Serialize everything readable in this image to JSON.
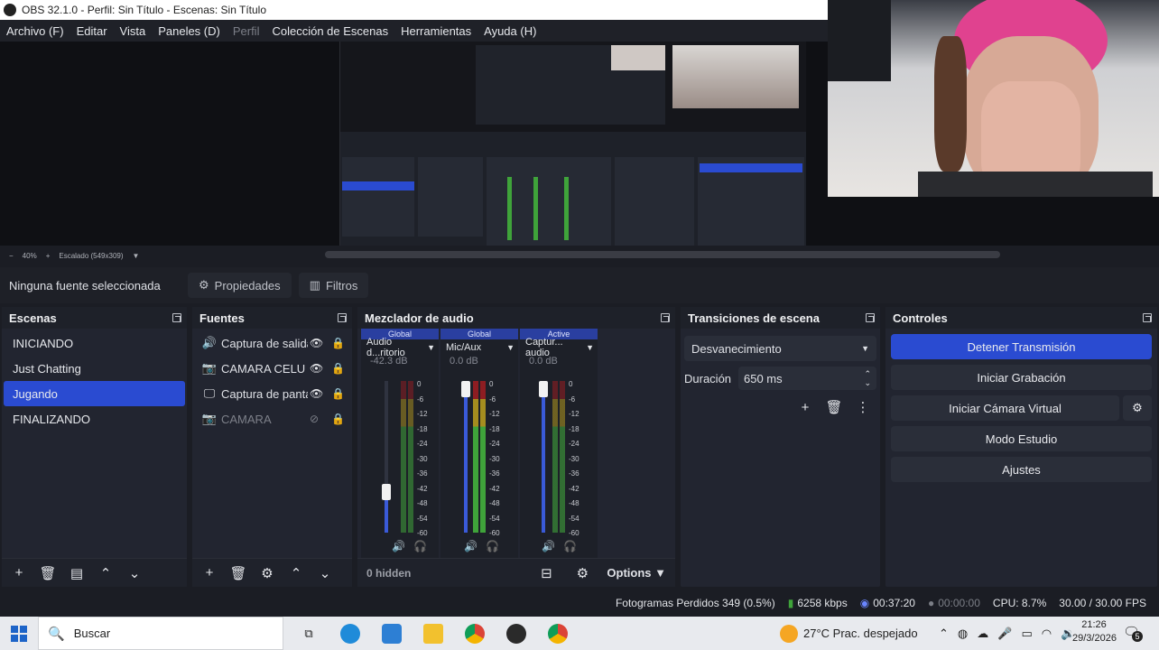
{
  "window": {
    "title": "OBS 32.1.0 - Perfil: Sin Título - Escenas: Sin Título"
  },
  "menu": [
    "Archivo (F)",
    "Editar",
    "Vista",
    "Paneles (D)",
    "Perfil",
    "Colección de Escenas",
    "Herramientas",
    "Ayuda (H)"
  ],
  "preview": {
    "zoom": "40%",
    "scale": "Escalado (549x309)"
  },
  "source_toolbar": {
    "selected": "Ninguna fuente seleccionada",
    "properties": "Propiedades",
    "filters": "Filtros"
  },
  "scenes": {
    "title": "Escenas",
    "items": [
      "INICIANDO",
      "Just Chatting",
      "Jugando",
      "FINALIZANDO"
    ],
    "selected_index": 2
  },
  "sources": {
    "title": "Fuentes",
    "items": [
      {
        "label": "Captura de salida",
        "icon": "speaker-icon",
        "visible": true
      },
      {
        "label": "CAMARA CELU",
        "icon": "camera-icon",
        "visible": true
      },
      {
        "label": "Captura de pantalla",
        "icon": "monitor-icon",
        "visible": true
      },
      {
        "label": "CAMARA",
        "icon": "camera-icon",
        "visible": false
      }
    ]
  },
  "mixer": {
    "title": "Mezclador de audio",
    "channels": [
      {
        "badge": "Global",
        "name": "Audio d...ritorio",
        "db": "-42.3 dB",
        "fader_level": 0.22,
        "meter_level": 0.0
      },
      {
        "badge": "Global",
        "name": "Mic/Aux",
        "db": "0.0 dB",
        "fader_level": 1.0,
        "meter_level": 0.55
      },
      {
        "badge": "Active",
        "name": "Captur... audio",
        "db": "0.0 dB",
        "fader_level": 1.0,
        "meter_level": 0.0
      }
    ],
    "scale": [
      "0",
      "-6",
      "-12",
      "-18",
      "-24",
      "-30",
      "-36",
      "-42",
      "-48",
      "-54",
      "-60"
    ],
    "hidden_label": "0 hidden",
    "options_label": "Options"
  },
  "transitions": {
    "title": "Transiciones de escena",
    "selected": "Desvanecimiento",
    "duration_label": "Duración",
    "duration_value": "650 ms"
  },
  "controls": {
    "title": "Controles",
    "stop_stream": "Detener Transmisión",
    "start_recording": "Iniciar Grabación",
    "start_virtual_cam": "Iniciar Cámara Virtual",
    "studio_mode": "Modo Estudio",
    "settings": "Ajustes"
  },
  "status": {
    "dropped_frames": "Fotogramas Perdidos 349 (0.5%)",
    "bitrate": "6258 kbps",
    "stream_time": "00:37:20",
    "record_time": "00:00:00",
    "cpu": "CPU: 8.7%",
    "fps": "30.00 / 30.00 FPS"
  },
  "taskbar": {
    "search_placeholder": "Buscar",
    "weather": "27°C  Prac. despejado",
    "time": "21:26",
    "date": "29/3/2026",
    "notification_count": "5"
  },
  "colors": {
    "accent": "#2a4bd1",
    "meter_green": "#3fa33a",
    "meter_yellow": "#a58d1f",
    "meter_red": "#8e1d22"
  }
}
